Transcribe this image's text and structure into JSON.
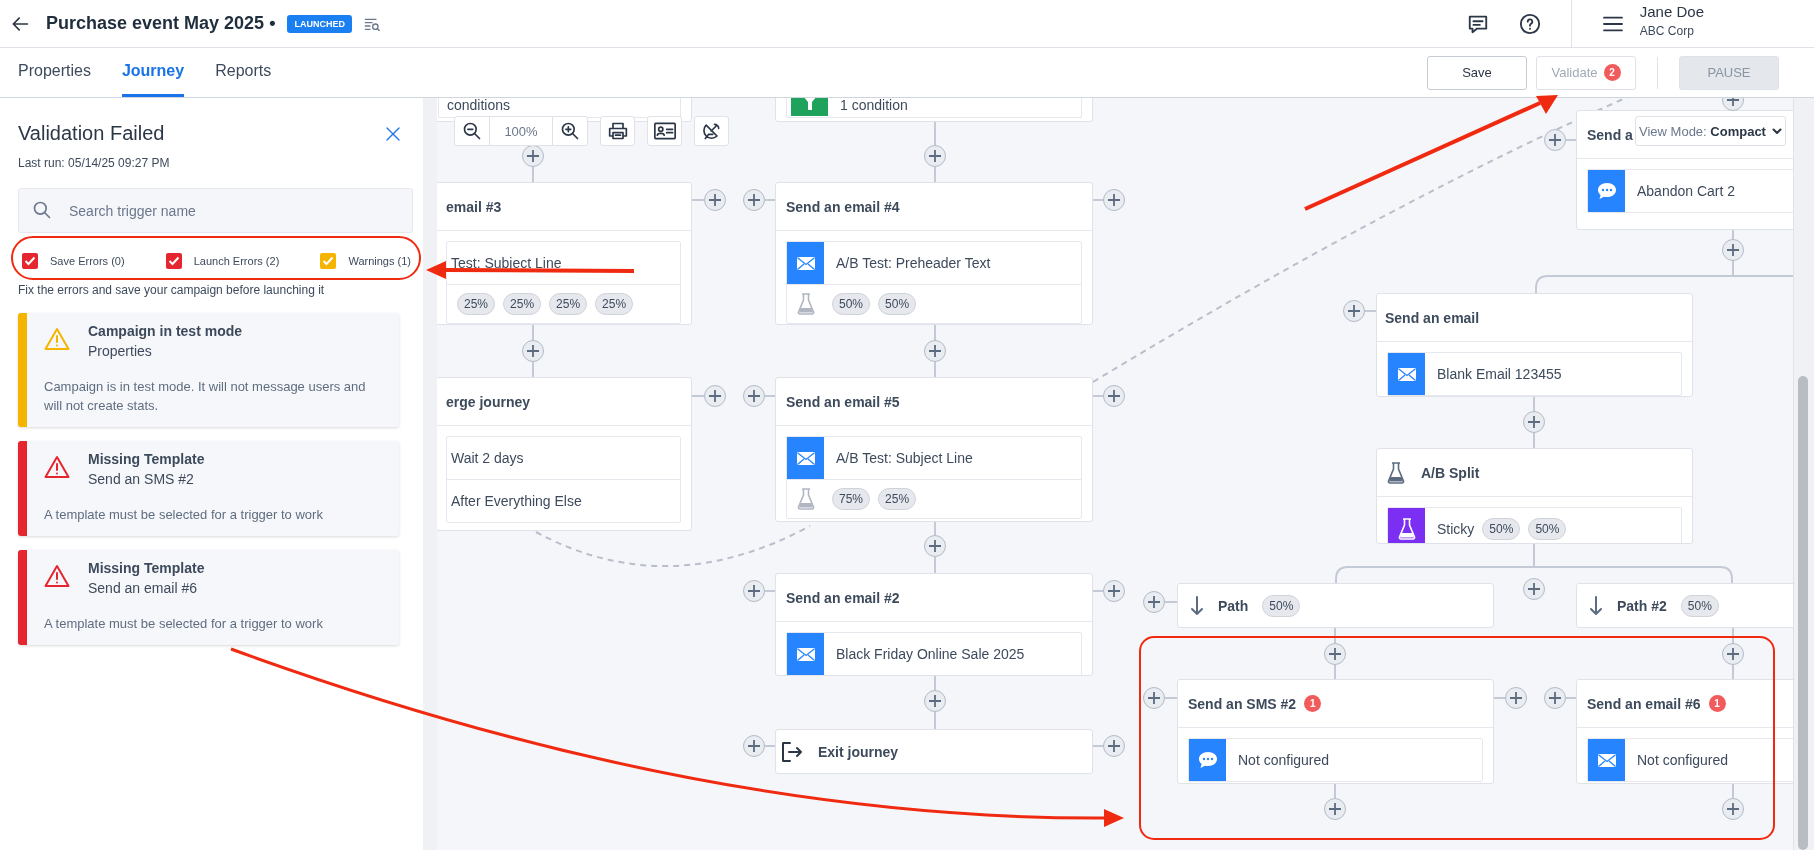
{
  "header": {
    "title": "Purchase event May 2025 •",
    "status_badge": "LAUNCHED",
    "user": {
      "name": "Jane Doe",
      "company": "ABC Corp"
    }
  },
  "tabs": [
    {
      "label": "Properties",
      "selected": false
    },
    {
      "label": "Journey",
      "selected": true
    },
    {
      "label": "Reports",
      "selected": false
    }
  ],
  "actions": [
    {
      "kind": "save",
      "label": "Save",
      "disabled": false
    },
    {
      "kind": "validate",
      "label": "Validate",
      "badge": "2",
      "disabled": true
    },
    {
      "kind": "pause",
      "label": "PAUSE",
      "disabled": true
    }
  ],
  "validation_panel": {
    "title": "Validation Failed",
    "last_run": "Last run: 05/14/25 09:27 PM",
    "search": {
      "placeholder": "Search trigger name"
    },
    "filters": [
      {
        "label": "Save Errors (0)",
        "checked": true,
        "color": "#e5262f"
      },
      {
        "label": "Launch Errors (2)",
        "checked": true,
        "color": "#e5262f"
      },
      {
        "label": "Warnings (1)",
        "checked": true,
        "color": "#f5b400"
      }
    ],
    "note": "Fix the errors and save your campaign before launching it",
    "issues": [
      {
        "kind": "warning",
        "title": "Campaign in test mode",
        "source": "Properties",
        "message": "Campaign is in test mode. It will not message users and will not create stats."
      },
      {
        "kind": "error",
        "title": "Missing Template",
        "source": "Send an SMS #2",
        "message": "A template must be selected for a trigger to work"
      },
      {
        "kind": "error",
        "title": "Missing Template",
        "source": "Send an email #6",
        "message": "A template must be selected for a trigger to work"
      }
    ]
  },
  "canvas": {
    "zoom": "100%",
    "view_mode": "View Mode: **Compact**",
    "nodes": [
      {
        "kind": "fragment",
        "rows": [
          {
            "kind": "plain",
            "text": "conditions"
          }
        ]
      },
      {
        "kind": "fragment",
        "rows": [
          {
            "kind": "condition",
            "text": "1 condition"
          }
        ]
      },
      {
        "kind": "step",
        "title": "email #3",
        "rows": [
          {
            "kind": "plain",
            "text": "Test: Subject Line"
          },
          {
            "kind": "chips",
            "chips": [
              "25%",
              "25%",
              "25%",
              "25%"
            ]
          }
        ]
      },
      {
        "kind": "step",
        "title": "Send an email #4",
        "rows": [
          {
            "kind": "email",
            "text": "A/B Test: Preheader Text"
          },
          {
            "kind": "split",
            "chips": [
              "50%",
              "50%"
            ]
          }
        ]
      },
      {
        "kind": "step",
        "title": "erge journey",
        "rows": [
          {
            "kind": "plain",
            "text": "Wait 2 days"
          },
          {
            "kind": "plain",
            "text": "After Everything Else"
          }
        ]
      },
      {
        "kind": "step",
        "title": "Send an email #5",
        "rows": [
          {
            "kind": "email",
            "text": "A/B Test: Subject Line"
          },
          {
            "kind": "split",
            "chips": [
              "75%",
              "25%"
            ]
          }
        ]
      },
      {
        "kind": "step",
        "title": "Send an email #2",
        "rows": [
          {
            "kind": "email",
            "text": "Black Friday Online Sale 2025"
          }
        ]
      },
      {
        "kind": "exit",
        "title": "Exit journey"
      },
      {
        "kind": "step",
        "title": "Send a",
        "rows": [
          {
            "kind": "sms",
            "text": "Abandon Cart 2"
          }
        ]
      },
      {
        "kind": "step",
        "title": "Send an email",
        "rows": [
          {
            "kind": "email",
            "text": "Blank Email 123455"
          }
        ]
      },
      {
        "kind": "ab_split",
        "title": "A/B Split",
        "rows": [
          {
            "kind": "abtest",
            "text": "Sticky",
            "chips": [
              "50%",
              "50%"
            ]
          }
        ]
      },
      {
        "kind": "path",
        "title": "Path",
        "chip": "50%"
      },
      {
        "kind": "path",
        "title": "Path #2",
        "chip": "50%"
      },
      {
        "kind": "step",
        "title": "Send an SMS #2",
        "badge": "1",
        "rows": [
          {
            "kind": "sms",
            "text": "Not configured"
          }
        ]
      },
      {
        "kind": "step",
        "title": "Send an email #6",
        "badge": "1",
        "rows": [
          {
            "kind": "email",
            "text": "Not configured"
          }
        ]
      }
    ]
  }
}
